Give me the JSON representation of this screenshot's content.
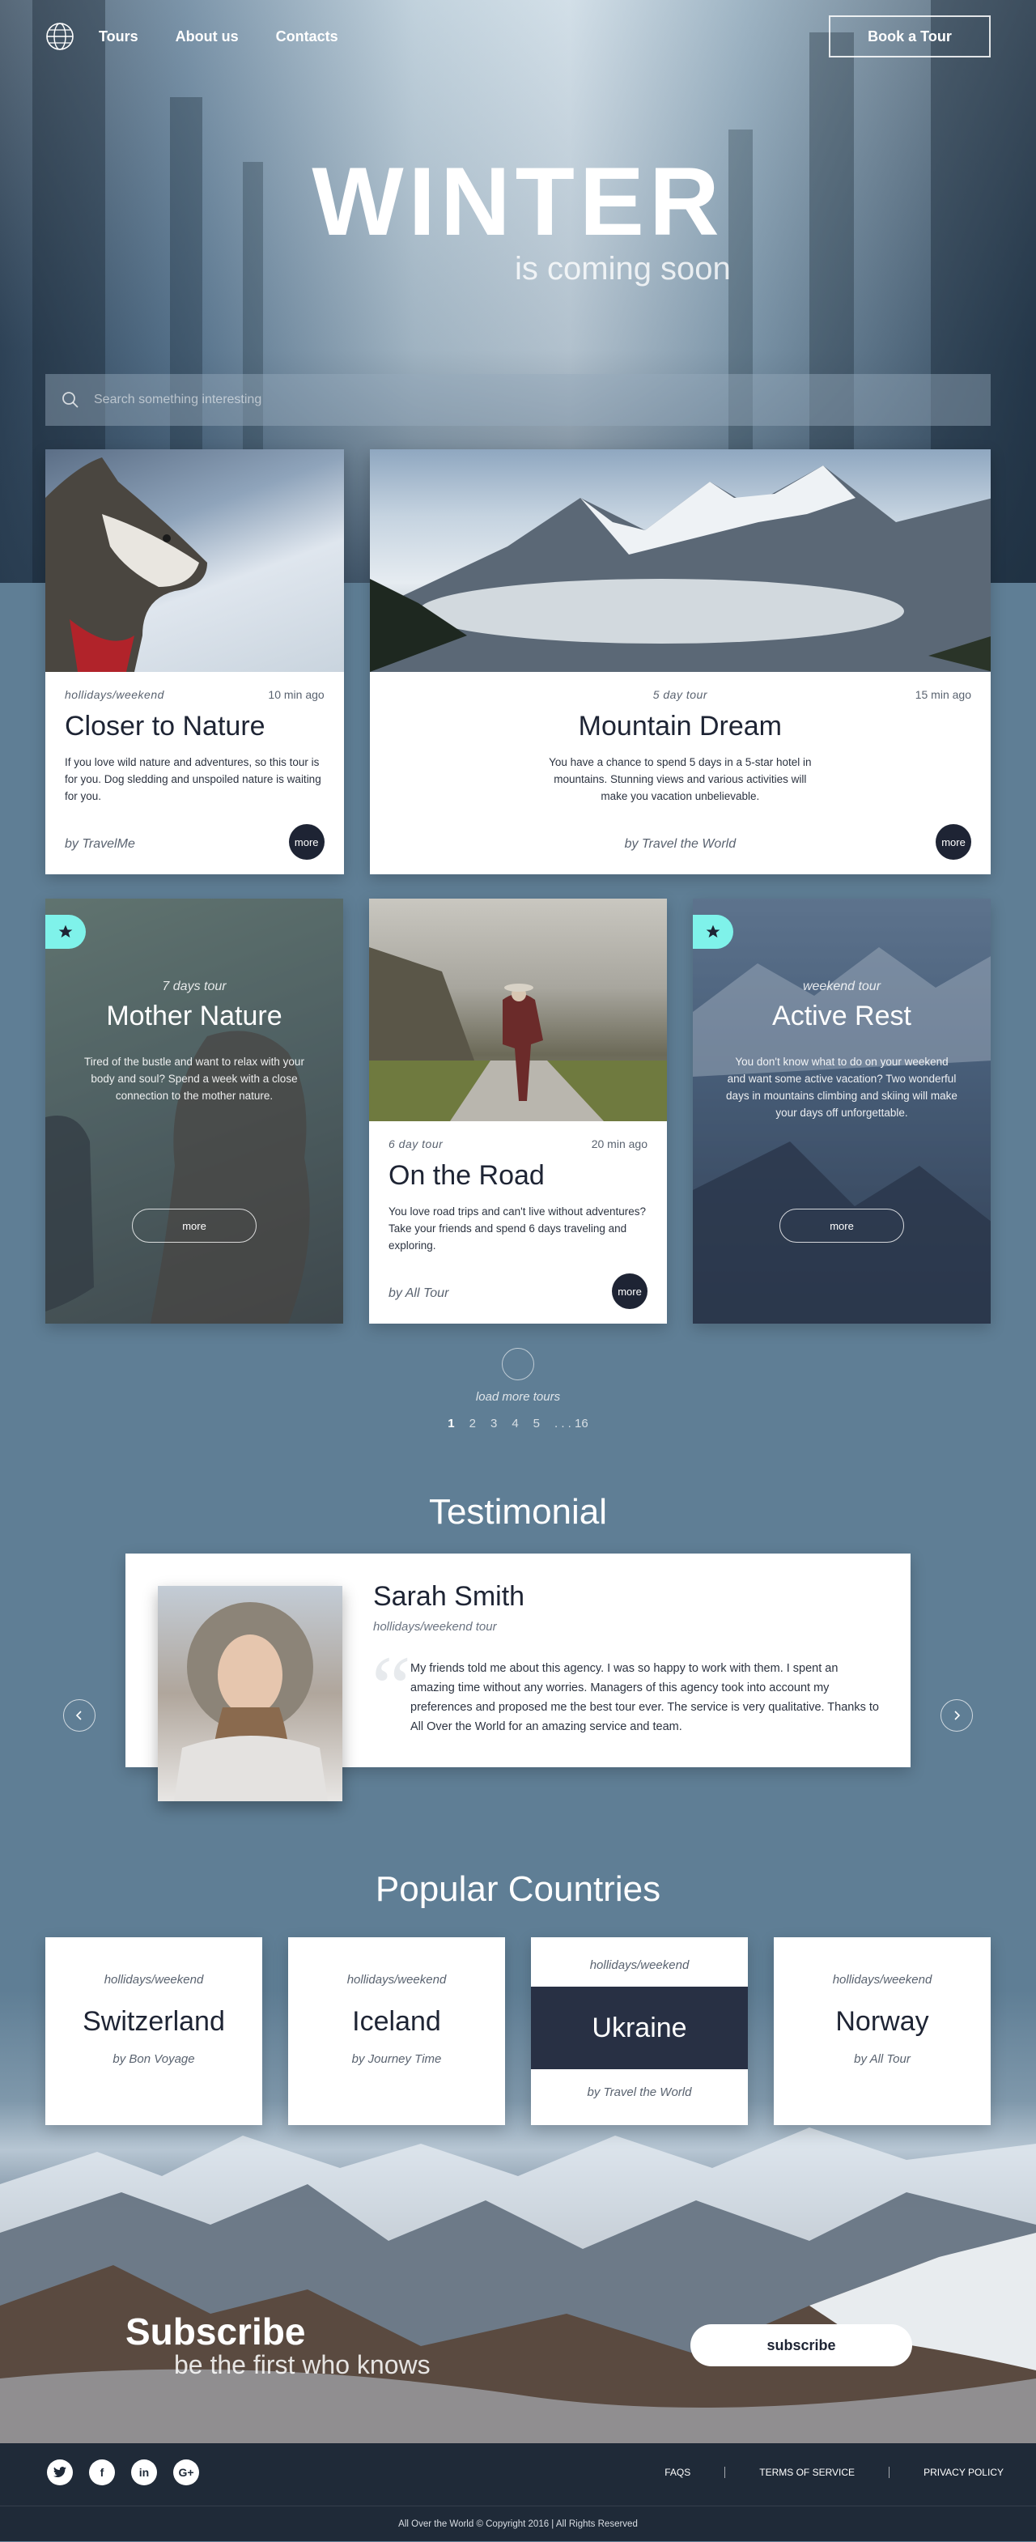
{
  "nav": {
    "links": [
      "Tours",
      "About us",
      "Contacts"
    ],
    "book_label": "Book a Tour"
  },
  "hero": {
    "title": "WINTER",
    "subtitle": "is coming soon"
  },
  "search": {
    "placeholder": "Search something interesting"
  },
  "tours": [
    {
      "category": "hollidays/weekend",
      "time": "10 min ago",
      "title": "Closer to Nature",
      "text": "If you love wild nature and adventures, so this tour is for you.  Dog sledding and unspoiled nature is waiting for you.",
      "author": "by TravelMe",
      "more": "more"
    },
    {
      "category": "5 day tour",
      "time": "15 min ago",
      "title": "Mountain Dream",
      "text": "You have a chance to spend 5 days in a 5-star hotel in mountains. Stunning views and various activities will make you vacation unbelievable.",
      "author": "by Travel the World",
      "more": "more"
    },
    {
      "category": "7 days tour",
      "title": "Mother Nature",
      "text": "Tired of the bustle and want to relax with your body and soul? Spend a week with a close connection to the mother nature.",
      "more": "more"
    },
    {
      "category": "6 day tour",
      "time": "20 min ago",
      "title": "On the Road",
      "text": "You love road trips and can't live without adventures? Take your friends and spend 6 days traveling and exploring.",
      "author": "by All Tour",
      "more": "more"
    },
    {
      "category": "weekend tour",
      "title": "Active Rest",
      "text": "You don't know what to do on your weekend and want some active vacation? Two wonderful days in mountains climbing and skiing will make your days off unforgettable.",
      "more": "more"
    }
  ],
  "pagination": {
    "load_more": "load more tours",
    "pages": [
      "1",
      "2",
      "3",
      "4",
      "5",
      ". . . 16"
    ]
  },
  "testimonial": {
    "heading": "Testimonial",
    "name": "Sarah Smith",
    "role": "hollidays/weekend tour",
    "quote": "My friends told me about this agency. I was so happy to work with them. I spent an amazing time without any worries. Managers of this agency took into account my preferences and proposed me the best tour ever. The service is very qualitative. Thanks to All Over the World for an amazing service and team."
  },
  "countries": {
    "heading": "Popular Countries",
    "items": [
      {
        "category": "hollidays/weekend",
        "name": "Switzerland",
        "by": "by Bon Voyage"
      },
      {
        "category": "hollidays/weekend",
        "name": "Iceland",
        "by": "by Journey Time"
      },
      {
        "category": "hollidays/weekend",
        "name": "Ukraine",
        "by": "by Travel the World"
      },
      {
        "category": "hollidays/weekend",
        "name": "Norway",
        "by": "by All Tour"
      }
    ]
  },
  "subscribe": {
    "title": "Subscribe",
    "subtitle": "be the first who knows",
    "button": "subscribe"
  },
  "footer": {
    "socials": [
      "twitter-icon",
      "facebook-icon",
      "linkedin-icon",
      "google-plus-icon"
    ],
    "links": [
      "FAQS",
      "TERMS OF SERVICE",
      "PRIVACY POLICY"
    ],
    "copyright": "All Over the World © Copyright 2016 | All Rights Reserved"
  },
  "colors": {
    "accent": "#7ff2ea",
    "dark": "#1e2434",
    "page_bg": "#5f7e95",
    "footer_bg": "#1f2a38"
  }
}
